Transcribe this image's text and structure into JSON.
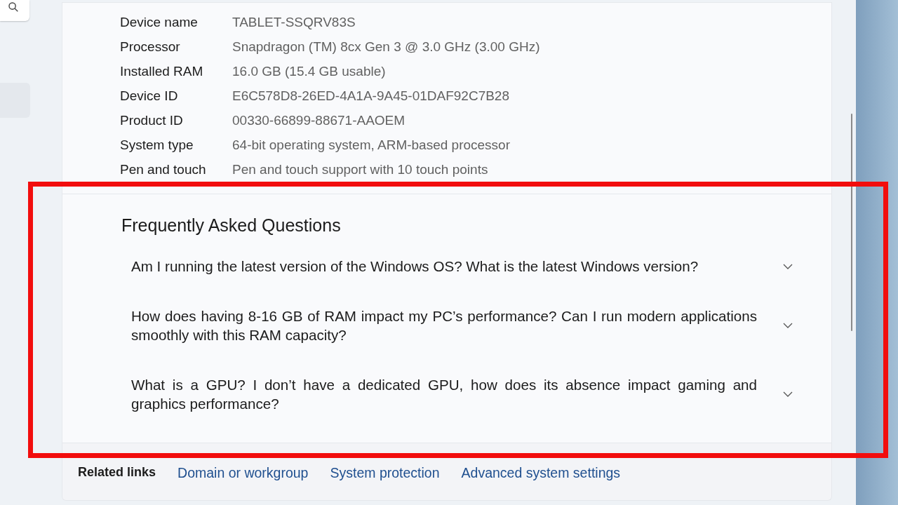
{
  "device_specs": [
    {
      "label": "Device name",
      "value": "TABLET-SSQRV83S"
    },
    {
      "label": "Processor",
      "value": "Snapdragon (TM) 8cx Gen 3 @ 3.0 GHz (3.00 GHz)"
    },
    {
      "label": "Installed RAM",
      "value": "16.0 GB (15.4 GB usable)"
    },
    {
      "label": "Device ID",
      "value": "E6C578D8-26ED-4A1A-9A45-01DAF92C7B28"
    },
    {
      "label": "Product ID",
      "value": "00330-66899-88671-AAOEM"
    },
    {
      "label": "System type",
      "value": "64-bit operating system, ARM-based processor"
    },
    {
      "label": "Pen and touch",
      "value": "Pen and touch support with 10 touch points"
    }
  ],
  "faq": {
    "title": "Frequently Asked Questions",
    "questions": [
      {
        "text": "Am I running the latest version of the Windows OS? What is the latest Windows version?",
        "expanded": false
      },
      {
        "text": "How does having 8-16 GB of RAM impact my PC’s performance? Can I run modern applications smoothly with this RAM capacity?",
        "expanded": false
      },
      {
        "text": "What is a GPU? I don’t have a dedicated GPU, how does its absence impact gaming and graphics performance?",
        "expanded": false
      }
    ]
  },
  "related_links": {
    "label": "Related links",
    "links": [
      "Domain or workgroup",
      "System protection",
      "Advanced system settings"
    ]
  }
}
